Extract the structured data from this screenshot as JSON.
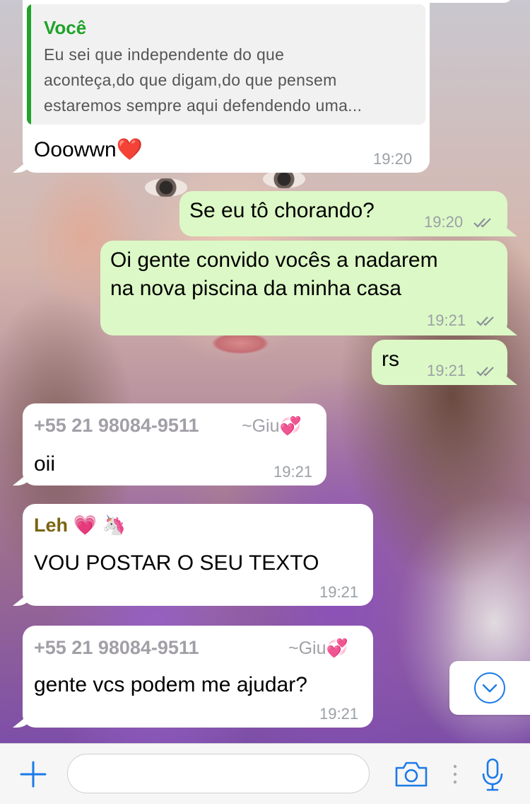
{
  "quoted_reply": {
    "author": "Você",
    "lines": [
      "Eu sei que independente do que",
      "aconteça,do que digam,do que pensem",
      "estaremos sempre aqui defendendo uma..."
    ]
  },
  "messages": [
    {
      "direction": "in",
      "text": "Ooowwn❤️",
      "time": "19:20"
    },
    {
      "direction": "out",
      "text": "Se eu tô chorando?",
      "time": "19:20"
    },
    {
      "direction": "out",
      "lines": [
        "Oi gente convido vocês a nadarem",
        "na nova piscina da minha casa"
      ],
      "time": "19:21"
    },
    {
      "direction": "out",
      "text": "rs",
      "time": "19:21"
    },
    {
      "direction": "in",
      "sender": "+55 21 98084-9511",
      "alias": "~Giu💞",
      "text": "oii",
      "time": "19:21"
    },
    {
      "direction": "in",
      "sender": "Leh 💗 🦄",
      "text": "VOU POSTAR O SEU TEXTO",
      "time": "19:21"
    },
    {
      "direction": "in",
      "sender": "+55 21 98084-9511",
      "alias": "~Giu💞",
      "text": "gente vcs podem me ajudar?",
      "time": "19:21"
    }
  ],
  "input": {
    "value": "",
    "placeholder": ""
  },
  "icons": {
    "attach": "plus-icon",
    "camera": "camera-icon",
    "more": "vertical-dots-icon",
    "mic": "microphone-icon",
    "scroll": "chevron-down-circle-icon",
    "read": "double-check-icon"
  },
  "colors": {
    "outgoing_bubble": "#dcf8c6",
    "incoming_bubble": "#ffffff",
    "quote_accent": "#1fa32a",
    "sender_leh": "#7a6410",
    "ios_blue": "#1a7ae8",
    "read_ticks": "#8a9099"
  }
}
